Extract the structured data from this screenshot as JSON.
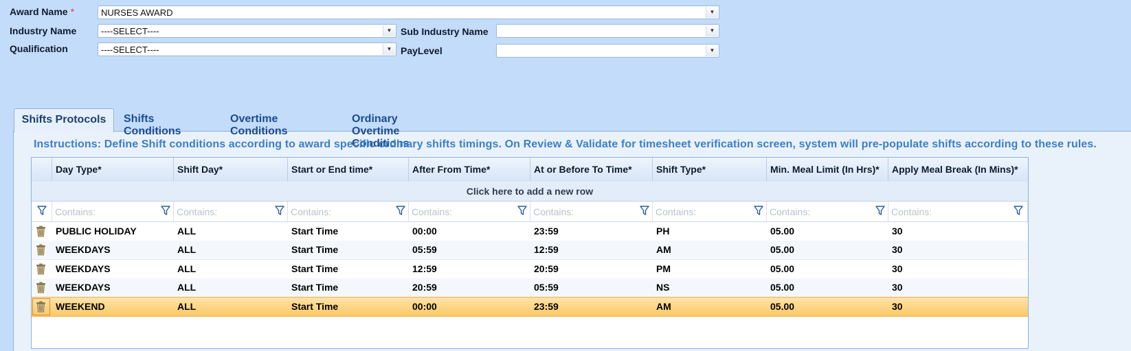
{
  "form": {
    "award_label": "Award Name",
    "award_required": "*",
    "award_value": "NURSES AWARD",
    "industry_label": "Industry Name",
    "industry_value": "----SELECT----",
    "sub_industry_label": "Sub Industry Name",
    "sub_industry_value": "",
    "qualification_label": "Qualification",
    "qualification_value": "----SELECT----",
    "paylevel_label": "PayLevel",
    "paylevel_value": ""
  },
  "tabs": [
    {
      "label": "Shifts Protocols",
      "active": true
    },
    {
      "label": "Shifts Conditions",
      "active": false
    },
    {
      "label": "Overtime Conditions",
      "active": false
    },
    {
      "label": "Ordinary Overtime Conditions",
      "active": false
    }
  ],
  "instructions": "Instructions: Define Shift conditions according to award specific ordinary shifts timings. On Review & Validate for timesheet verification screen, system will pre-populate shifts according to these rules.",
  "grid": {
    "columns": [
      "Day Type*",
      "Shift Day*",
      "Start or End time*",
      "After From Time*",
      "At or Before To Time*",
      "Shift Type*",
      "Min. Meal Limit (In Hrs)*",
      "Apply Meal Break (In Mins)*"
    ],
    "add_row_text": "Click here to add a new row",
    "filter_placeholder": "Contains:",
    "rows": [
      [
        "PUBLIC HOLIDAY",
        "ALL",
        "Start Time",
        "00:00",
        "23:59",
        "PH",
        "05.00",
        "30"
      ],
      [
        "WEEKDAYS",
        "ALL",
        "Start Time",
        "05:59",
        "12:59",
        "AM",
        "05.00",
        "30"
      ],
      [
        "WEEKDAYS",
        "ALL",
        "Start Time",
        "12:59",
        "20:59",
        "PM",
        "05.00",
        "30"
      ],
      [
        "WEEKDAYS",
        "ALL",
        "Start Time",
        "20:59",
        "05:59",
        "NS",
        "05.00",
        "30"
      ],
      [
        "WEEKEND",
        "ALL",
        "Start Time",
        "00:00",
        "23:59",
        "AM",
        "05.00",
        "30"
      ]
    ],
    "selected_row": 4
  },
  "colors": {
    "background": "#c3dcfa",
    "tab_text": "#1c4b8f",
    "instructions_text": "#3d7fc6",
    "selected_row": "#fbc967",
    "required_marker": "#e03a3a"
  }
}
